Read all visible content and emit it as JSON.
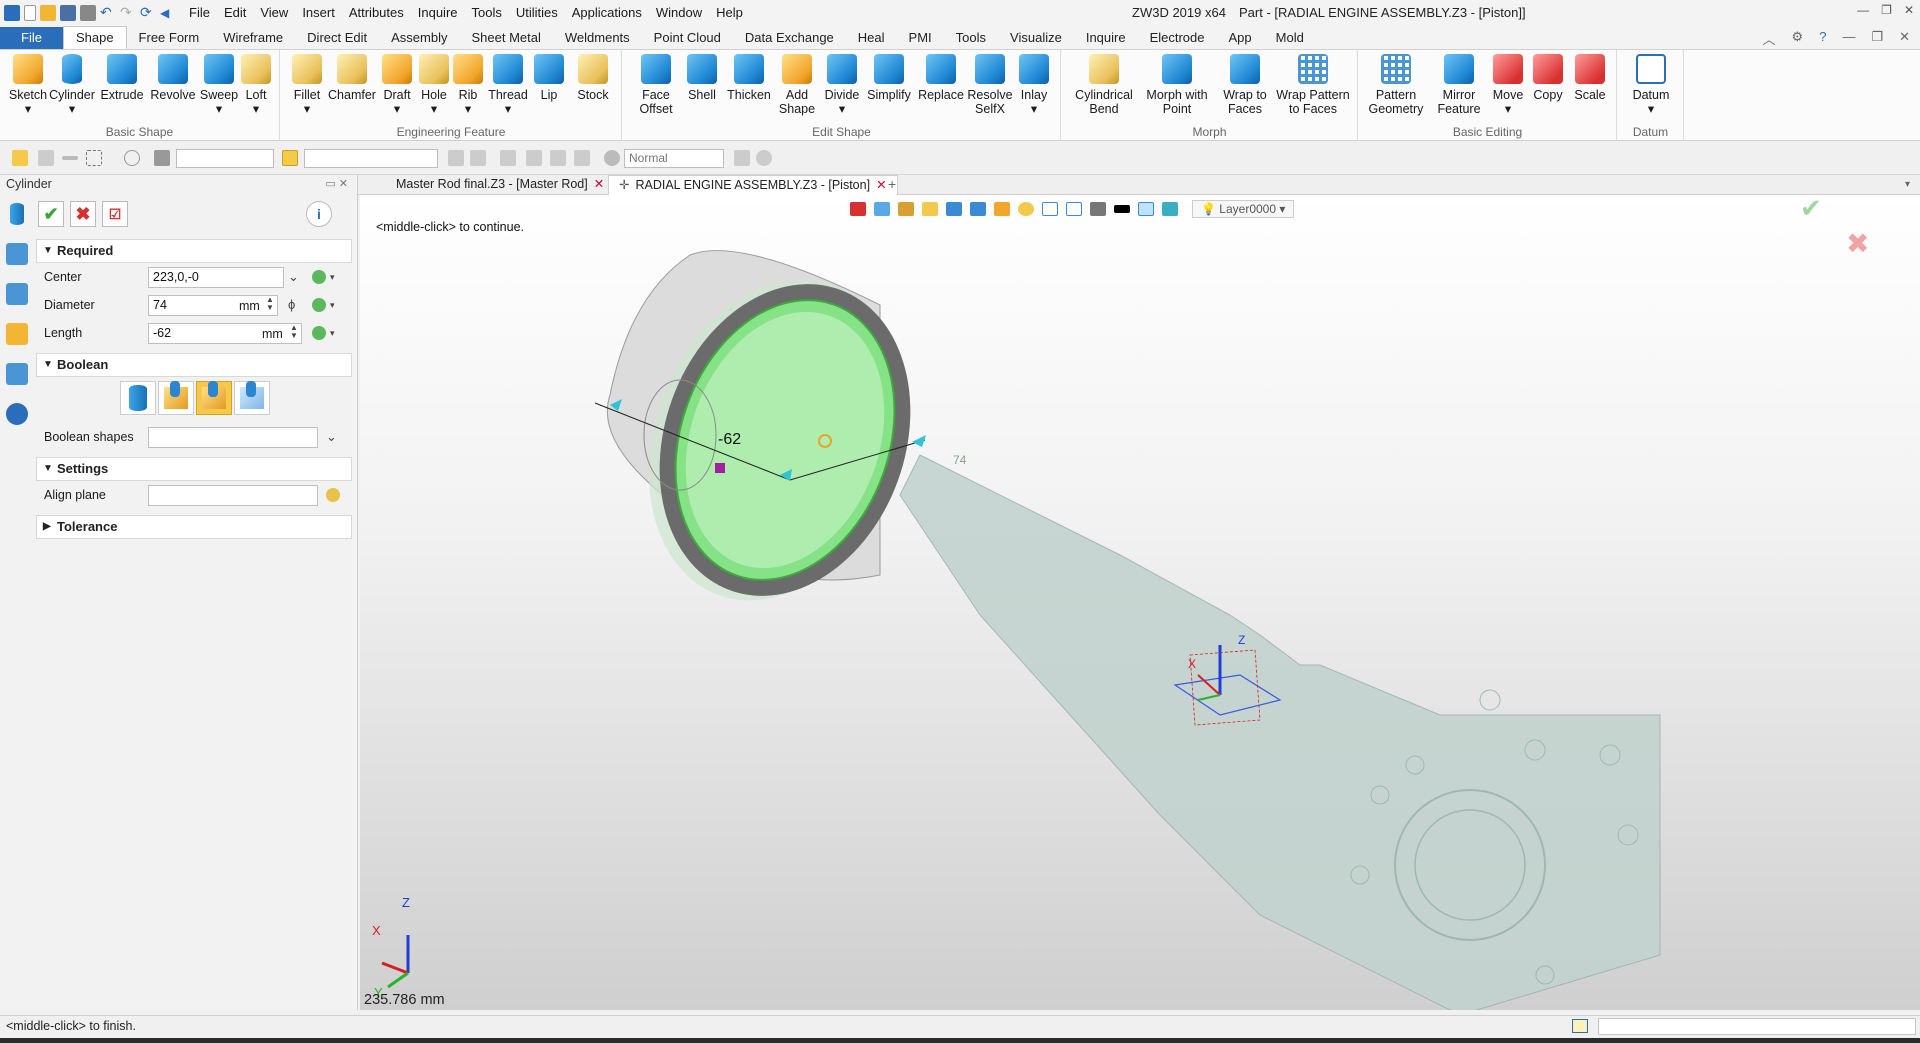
{
  "titlebar": {
    "menu": [
      "File",
      "Edit",
      "View",
      "Insert",
      "Attributes",
      "Inquire",
      "Tools",
      "Utilities",
      "Applications",
      "Window",
      "Help"
    ],
    "app_title": "ZW3D 2019  x64",
    "doc_title": "Part - [RADIAL ENGINE ASSEMBLY.Z3 - [Piston]]"
  },
  "ribbon_tabs": [
    "File",
    "Shape",
    "Free Form",
    "Wireframe",
    "Direct Edit",
    "Assembly",
    "Sheet Metal",
    "Weldments",
    "Point Cloud",
    "Data Exchange",
    "Heal",
    "PMI",
    "Tools",
    "Visualize",
    "Inquire",
    "Electrode",
    "App",
    "Mold"
  ],
  "ribbon_active": "Shape",
  "ribbon_groups": {
    "basic_shape": {
      "title": "Basic Shape",
      "buttons": [
        "Sketch",
        "Cylinder",
        "Extrude",
        "Revolve",
        "Sweep",
        "Loft"
      ]
    },
    "engineering_feature": {
      "title": "Engineering Feature",
      "buttons": [
        "Fillet",
        "Chamfer",
        "Draft",
        "Hole",
        "Rib",
        "Thread",
        "Lip",
        "Stock"
      ]
    },
    "edit_shape": {
      "title": "Edit Shape",
      "buttons": [
        "Face Offset",
        "Shell",
        "Thicken",
        "Add Shape",
        "Divide",
        "Simplify",
        "Replace",
        "Resolve SelfX",
        "Inlay"
      ]
    },
    "morph": {
      "title": "Morph",
      "buttons": [
        "Cylindrical Bend",
        "Morph with Point",
        "Wrap to Faces",
        "Wrap Pattern to Faces"
      ]
    },
    "basic_editing": {
      "title": "Basic Editing",
      "buttons": [
        "Pattern Geometry",
        "Mirror Feature",
        "Move",
        "Copy",
        "Scale"
      ]
    },
    "datum": {
      "title": "Datum",
      "buttons": [
        "Datum"
      ]
    }
  },
  "toolbar2": {
    "render_mode": "Normal"
  },
  "panel": {
    "title": "Cylinder",
    "sections": {
      "required": "Required",
      "boolean": "Boolean",
      "settings": "Settings",
      "tolerance": "Tolerance"
    },
    "fields": {
      "center_label": "Center",
      "center_value": "223,0,-0",
      "diameter_label": "Diameter",
      "diameter_value": "74",
      "diameter_unit": "mm",
      "length_label": "Length",
      "length_value": "-62",
      "length_unit": "mm",
      "boolean_shapes_label": "Boolean shapes",
      "align_plane_label": "Align plane"
    },
    "boolean_selected_index": 2
  },
  "doc_tabs": [
    {
      "label": "Master Rod final.Z3 - [Master Rod]",
      "active": false
    },
    {
      "label": "RADIAL ENGINE ASSEMBLY.Z3 - [Piston]",
      "active": true
    }
  ],
  "viewport": {
    "prompt": "<middle-click> to continue.",
    "layer": "Layer0000",
    "dimension_length": "-62",
    "dimension_diameter": "74",
    "measure": "235.786 mm",
    "axis_labels": {
      "x": "X",
      "y": "Y",
      "z": "Z"
    }
  },
  "statusbar": {
    "message": "<middle-click> to finish."
  },
  "colors": {
    "accent": "#2a6ebb",
    "confirm": "#3aa63a",
    "cancel": "#d83030",
    "cylinder_preview": "#7fe07f"
  }
}
